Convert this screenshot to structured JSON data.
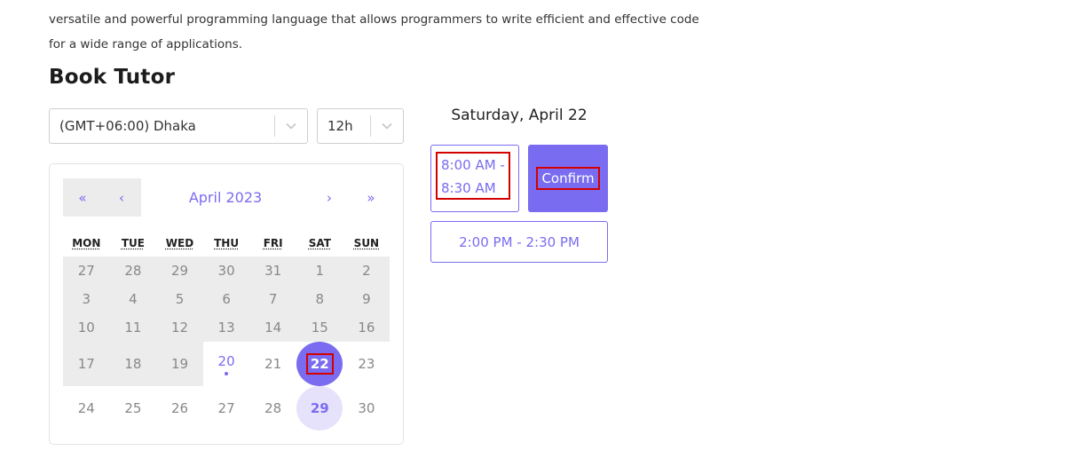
{
  "description": {
    "line1": "versatile and powerful programming language that allows programmers to write efficient and effective code",
    "line2": "for a wide range of applications."
  },
  "booking": {
    "heading": "Book Tutor",
    "timezone": "(GMT+06:00) Dhaka",
    "time_format": "12h"
  },
  "calendar": {
    "nav": {
      "first": "«",
      "prev": "‹",
      "month": "April 2023",
      "next": "›",
      "last": "»"
    },
    "weekdays": [
      "MON",
      "TUE",
      "WED",
      "THU",
      "FRI",
      "SAT",
      "SUN"
    ],
    "weeks": [
      [
        "27",
        "28",
        "29",
        "30",
        "31",
        "1",
        "2"
      ],
      [
        "3",
        "4",
        "5",
        "6",
        "7",
        "8",
        "9"
      ],
      [
        "10",
        "11",
        "12",
        "13",
        "14",
        "15",
        "16"
      ],
      [
        "17",
        "18",
        "19",
        "20",
        "21",
        "22",
        "23"
      ],
      [
        "24",
        "25",
        "26",
        "27",
        "28",
        "29",
        "30"
      ]
    ],
    "today": "20",
    "selected": "22"
  },
  "schedule": {
    "date_title": "Saturday, April 22",
    "slots": [
      {
        "line1": "8:00 AM -",
        "line2": "8:30 AM"
      },
      {
        "label": "2:00 PM - 2:30 PM"
      }
    ],
    "confirm_label": "Confirm"
  },
  "colors": {
    "accent": "#7a6cf0",
    "accent_light": "#e7e2fb",
    "disabled_bg": "#ececec",
    "highlight": "#d40000"
  }
}
